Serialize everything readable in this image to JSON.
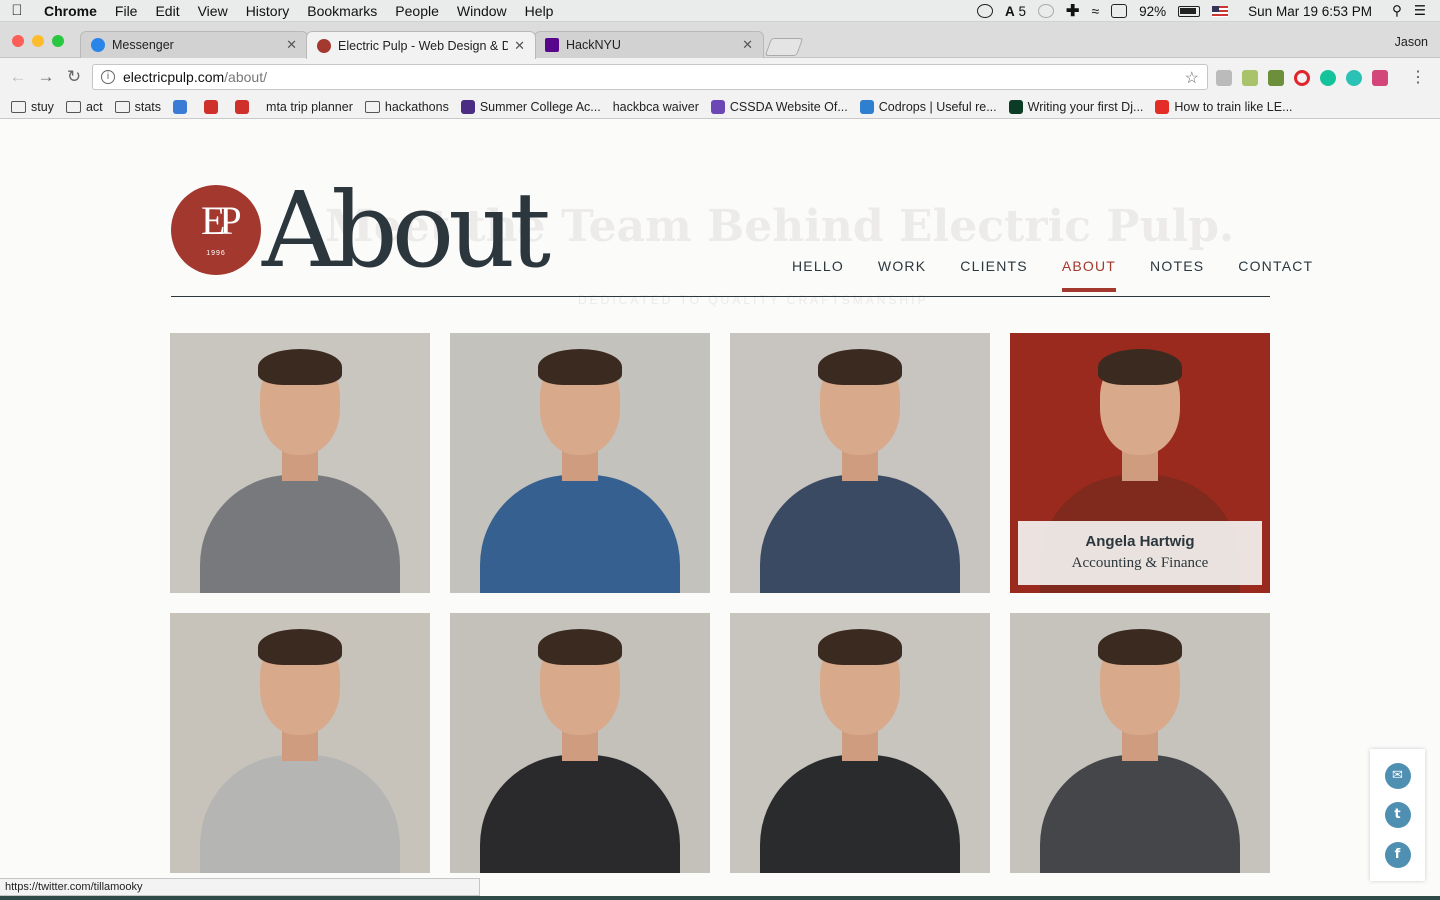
{
  "menubar": {
    "app": "Chrome",
    "items": [
      "File",
      "Edit",
      "View",
      "History",
      "Bookmarks",
      "People",
      "Window",
      "Help"
    ],
    "status": {
      "adobe_count": "5",
      "battery": "92%",
      "datetime": "Sun Mar 19  6:53 PM"
    }
  },
  "tabs": [
    {
      "title": "Messenger",
      "favicon_color": "#2b84e8",
      "active": false
    },
    {
      "title": "Electric Pulp - Web Design & D",
      "favicon_color": "#a3382f",
      "active": true
    },
    {
      "title": "HackNYU",
      "favicon_color": "#57068c",
      "active": false
    }
  ],
  "profile_name": "Jason",
  "url": {
    "host": "electricpulp.com",
    "path": "/about/"
  },
  "bookmarks": [
    {
      "label": "stuy",
      "icon": "folder-icon"
    },
    {
      "label": "act",
      "icon": "folder-icon"
    },
    {
      "label": "stats",
      "icon": "folder-icon"
    },
    {
      "label": "",
      "icon": "globe-icon",
      "color": "#3a7bd5"
    },
    {
      "label": "",
      "icon": "esd-icon",
      "color": "#d0302a"
    },
    {
      "label": "",
      "icon": "chart-icon",
      "color": "#d0302a"
    },
    {
      "label": "mta trip planner",
      "icon": "page-icon"
    },
    {
      "label": "hackathons",
      "icon": "folder-icon"
    },
    {
      "label": "Summer College Ac...",
      "icon": "college-icon",
      "color": "#4b2d83"
    },
    {
      "label": "hackbca waiver",
      "icon": "page-icon"
    },
    {
      "label": "CSSDA Website Of...",
      "icon": "cssda-icon",
      "color": "#6b48b5"
    },
    {
      "label": "Codrops | Useful re...",
      "icon": "codrops-icon",
      "color": "#2f7fd0"
    },
    {
      "label": "Writing your first Dj...",
      "icon": "django-icon",
      "color": "#0c3c26"
    },
    {
      "label": "How to train like LE...",
      "icon": "youtube-icon",
      "color": "#e52d27"
    }
  ],
  "page": {
    "logo_mark": "EP",
    "logo_year": "1996",
    "title": "About",
    "ghost_title": "Meet the Team Behind Electric Pulp.",
    "ghost_subtitle": "DEDICATED TO QUALITY CRAFTSMANSHIP",
    "nav": [
      "HELLO",
      "WORK",
      "CLIENTS",
      "ABOUT",
      "NOTES",
      "CONTACT"
    ],
    "active_nav": "ABOUT",
    "accent": "#a3382f",
    "ink": "#2b373d",
    "team": [
      {
        "shirt": "#77797c",
        "bg": "#c9c6c0"
      },
      {
        "shirt": "#35608f",
        "bg": "#c4c2bc"
      },
      {
        "shirt": "#3a4a63",
        "bg": "#c8c5c0"
      },
      {
        "shirt": "#7f2a1c",
        "bg": "#9b2a1e",
        "caption": {
          "name": "Angela Hartwig",
          "role": "Accounting & Finance"
        }
      },
      {
        "shirt": "#b5b5b3",
        "bg": "#c7c3bb"
      },
      {
        "shirt": "#2a2a2d",
        "bg": "#c4c1bb"
      },
      {
        "shirt": "#2a2b2d",
        "bg": "#c8c5bf"
      },
      {
        "shirt": "#444649",
        "bg": "#c6c3bd"
      }
    ]
  },
  "share": [
    "mail-icon",
    "twitter-icon",
    "facebook-icon"
  ],
  "status_url": "https://twitter.com/tillamooky"
}
